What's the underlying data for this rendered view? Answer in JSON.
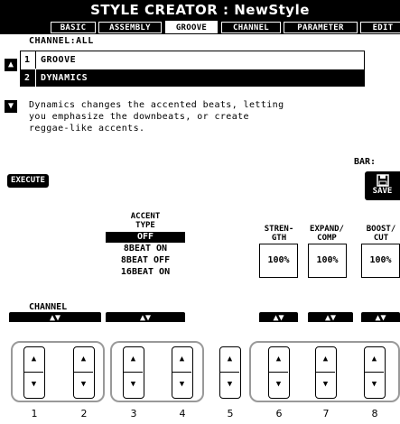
{
  "title": "STYLE CREATOR : NewStyle",
  "tabs": [
    "BASIC",
    "ASSEMBLY",
    "GROOVE",
    "CHANNEL",
    "PARAMETER",
    "EDIT"
  ],
  "channel_label": "CHANNEL:ALL",
  "list": [
    {
      "num": "1",
      "label": "GROOVE"
    },
    {
      "num": "2",
      "label": "DYNAMICS"
    }
  ],
  "description": [
    "Dynamics changes the accented beats, letting",
    "you emphasize the downbeats, or create",
    "reggae-like accents."
  ],
  "bar_label": "BAR:",
  "execute": "EXECUTE",
  "save": "SAVE",
  "channel_button_label": "CHANNEL",
  "accent": {
    "header1": "ACCENT",
    "header2": "TYPE",
    "options": [
      "OFF",
      "8BEAT ON",
      "8BEAT OFF",
      "16BEAT ON"
    ],
    "selected": "OFF"
  },
  "params": [
    {
      "header1": "STREN-",
      "header2": "GTH",
      "value": "100%"
    },
    {
      "header1": "EXPAND/",
      "header2": "COMP",
      "value": "100%"
    },
    {
      "header1": "BOOST/",
      "header2": "CUT",
      "value": "100%"
    }
  ],
  "arrow_glyph": "▲▼",
  "key_numbers": [
    "1",
    "2",
    "3",
    "4",
    "5",
    "6",
    "7",
    "8"
  ],
  "icons": {
    "up": "triangle-up",
    "down": "triangle-down",
    "save": "floppy-disk"
  }
}
